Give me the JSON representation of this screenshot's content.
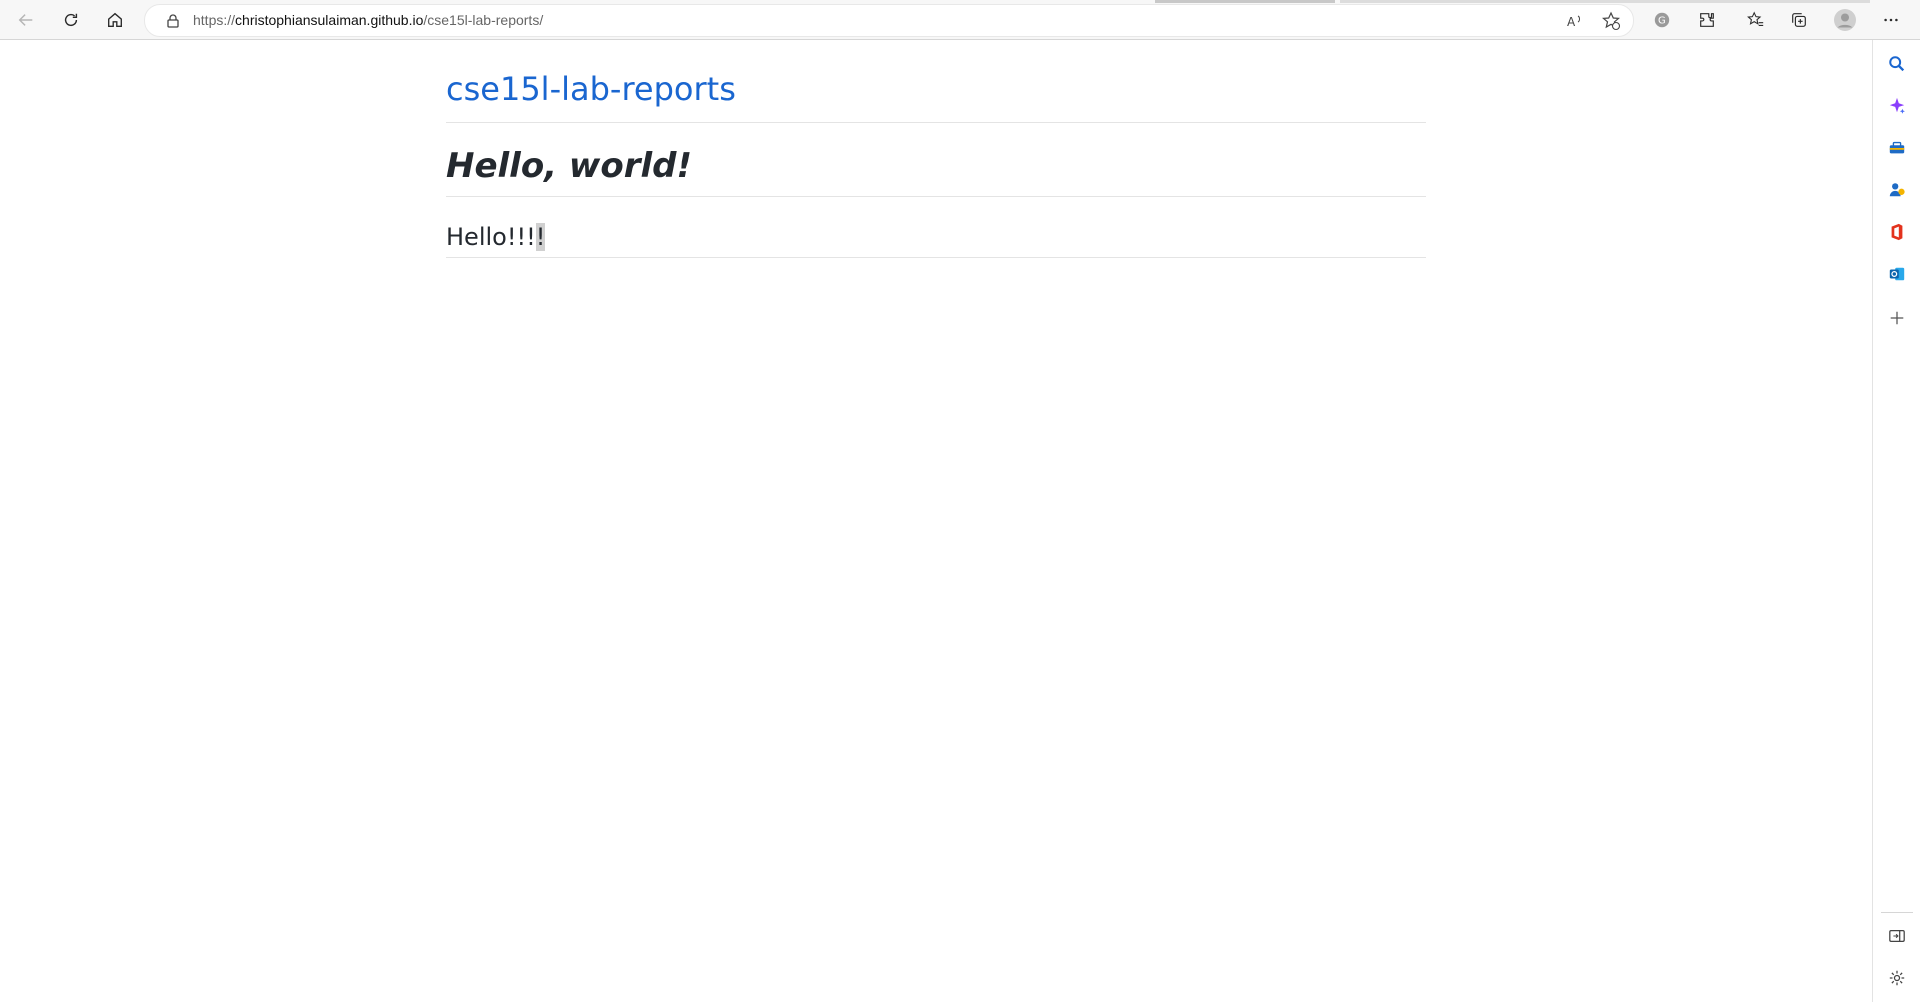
{
  "browser": {
    "url_prefix": "https://",
    "url_host": "christophiansulaiman.github.io",
    "url_path": "/cse15l-lab-reports/",
    "toolbar_icons": [
      "back-icon",
      "refresh-icon",
      "home-icon",
      "lock-icon",
      "read-aloud-icon",
      "add-favorite-icon",
      "grammarly-icon",
      "extensions-icon",
      "favorites-icon",
      "collections-icon",
      "profile-icon",
      "more-icon"
    ]
  },
  "sidebar": {
    "icons": [
      "search-icon",
      "copilot-icon",
      "tools-icon",
      "games-icon",
      "office-icon",
      "outlook-icon",
      "add-icon",
      "hide-sidebar-icon",
      "settings-icon"
    ]
  },
  "page": {
    "site_title": "cse15l-lab-reports",
    "heading": "Hello, world!",
    "paragraph_main": "Hello!!!",
    "paragraph_selected": "!"
  },
  "colors": {
    "link": "#1a66d0",
    "text": "#24292f"
  }
}
